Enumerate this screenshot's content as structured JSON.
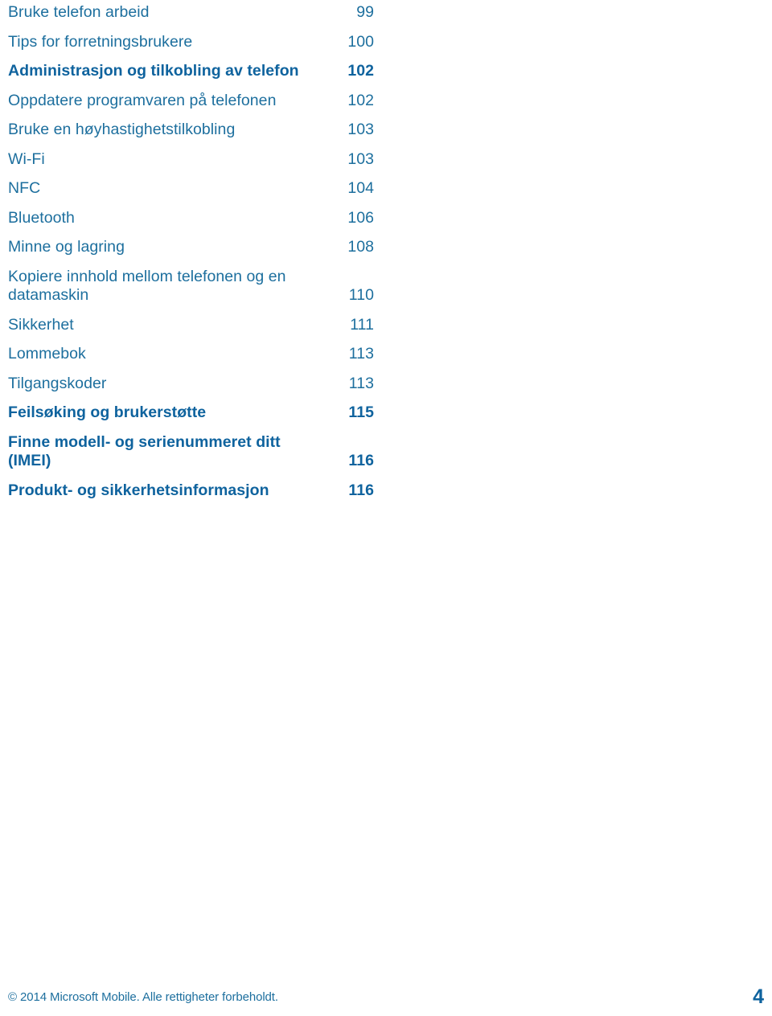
{
  "document": {
    "language": "Norwegian",
    "toc": {
      "entries": [
        {
          "label": "Bruke telefon arbeid",
          "page": "99",
          "bold": false
        },
        {
          "label": "Tips for forretningsbrukere",
          "page": "100",
          "bold": false
        },
        {
          "label": "Administrasjon og tilkobling av telefon",
          "page": "102",
          "bold": true
        },
        {
          "label": "Oppdatere programvaren på telefonen",
          "page": "102",
          "bold": false
        },
        {
          "label": "Bruke en høyhastighetstilkobling",
          "page": "103",
          "bold": false
        },
        {
          "label": "Wi-Fi",
          "page": "103",
          "bold": false
        },
        {
          "label": "NFC",
          "page": "104",
          "bold": false
        },
        {
          "label": "Bluetooth",
          "page": "106",
          "bold": false
        },
        {
          "label": "Minne og lagring",
          "page": "108",
          "bold": false
        },
        {
          "label": "Kopiere innhold mellom telefonen og en datamaskin",
          "page": "110",
          "bold": false
        },
        {
          "label": "Sikkerhet",
          "page": "111",
          "bold": false
        },
        {
          "label": "Lommebok",
          "page": "113",
          "bold": false
        },
        {
          "label": "Tilgangskoder",
          "page": "113",
          "bold": false
        },
        {
          "label": "Feilsøking og brukerstøtte",
          "page": "115",
          "bold": true
        },
        {
          "label": "Finne modell- og serienummeret ditt (IMEI)",
          "page": "116",
          "bold": true
        },
        {
          "label": "Produkt- og sikkerhetsinformasjon",
          "page": "116",
          "bold": true
        }
      ]
    },
    "footer": {
      "copyright": "© 2014 Microsoft Mobile. Alle rettigheter forbeholdt.",
      "page_number": "4"
    },
    "colors": {
      "text_regular": "#1d6f9e",
      "text_bold": "#0f639e",
      "background": "#ffffff"
    }
  }
}
